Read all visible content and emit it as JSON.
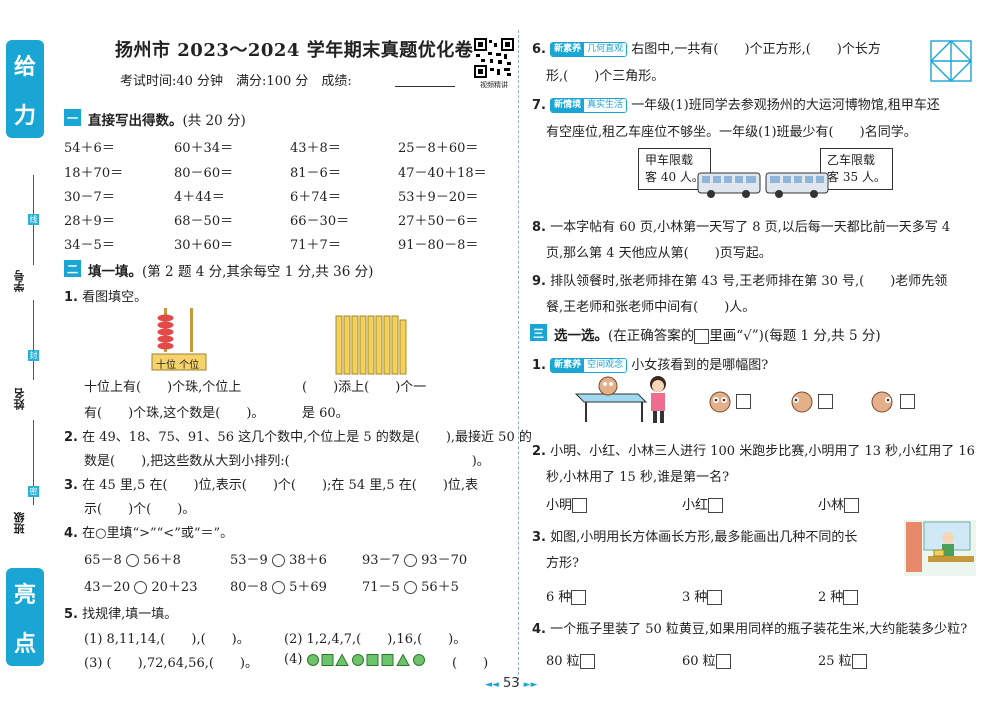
{
  "colors": {
    "accent": "#1aa6d4",
    "badge_green": "#2aa75a",
    "abacus_rod": "#c69a3c",
    "tab_text": "#ffffff"
  },
  "sidebar": {
    "top_tab": [
      "给",
      "力"
    ],
    "bottom_tab": [
      "亮",
      "点"
    ],
    "labels": [
      "学号",
      "姓名",
      "班级"
    ],
    "seals": [
      "线",
      "封",
      "密"
    ]
  },
  "header": {
    "title": "扬州市 2023～2024 学年期末真题优化卷",
    "subtitle": "考试时间:40 分钟　满分:100 分　成绩:",
    "qr_caption": "视频精讲"
  },
  "left": {
    "sec1": {
      "num": "一",
      "title": "直接写出得数。",
      "score": "(共 20 分)",
      "rows": [
        [
          "54＋6＝",
          "60＋34＝",
          "43＋8＝",
          "25－8＋60＝"
        ],
        [
          "18＋70＝",
          "80－60＝",
          "81－6＝",
          "47－40＋18＝"
        ],
        [
          "30－7＝",
          "4＋44＝",
          "6＋74＝",
          "53＋9－20＝"
        ],
        [
          "28＋9＝",
          "68－50＝",
          "66－30＝",
          "27＋50－6＝"
        ],
        [
          "34－5＝",
          "30＋60＝",
          "71＋7＝",
          "91－80－8＝"
        ]
      ]
    },
    "sec2": {
      "num": "二",
      "title": "填一填。",
      "score": "(第 2 题 4 分,其余每空 1 分,共 36 分)",
      "q1": {
        "n": "1.",
        "text": "看图填空。",
        "abacus_label": "十位 个位",
        "l1a": "十位上有(　　)个珠,个位上",
        "l1b": "(　　)添上(　　)个一",
        "l2a": "有(　　)个珠,这个数是(　　)。",
        "l2b": "是 60。"
      },
      "q2": {
        "n": "2.",
        "l1": "在 49、18、75、91、56 这几个数中,个位上是 5 的数是(　　),最接近 50 的",
        "l2": "数是(　　),把这些数从大到小排列:(　　　　　　　　　　　　　　)。"
      },
      "q3": {
        "n": "3.",
        "l1": "在 45 里,5 在(　　)位,表示(　　)个(　　);在 54 里,5 在(　　)位,表",
        "l2": "示(　　)个(　　)。"
      },
      "q4": {
        "n": "4.",
        "text": "在○里填“>”“<”或“＝”。",
        "rows": [
          [
            "65－8",
            "56＋8",
            "53－9",
            "38＋6",
            "93－7",
            "93－70"
          ],
          [
            "43－20",
            "20＋23",
            "80－8",
            "5＋69",
            "71－5",
            "56＋5"
          ]
        ]
      },
      "q5": {
        "n": "5.",
        "text": "找规律,填一填。",
        "p1": "(1) 8,11,14,(　　),(　　)。",
        "p2": "(2) 1,2,4,7,(　　),16,(　　)。",
        "p3": "(3) (　　),72,64,56,(　　)。",
        "p4": "(4)",
        "p4end": "(　　)"
      }
    }
  },
  "right": {
    "q6": {
      "n": "6.",
      "badge": [
        "新素养",
        "几何直观"
      ],
      "l1": "右图中,一共有(　　)个正方形,(　　)个长方",
      "l2": "形,(　　)个三角形。"
    },
    "q7": {
      "n": "7.",
      "badge": [
        "新情境",
        "真实生活"
      ],
      "l1": "一年级(1)班同学去参观扬州的大运河博物馆,租甲车还",
      "l2": "有空座位,租乙车座位不够坐。一年级(1)班最少有(　　)名同学。",
      "sign1": [
        "甲车限载",
        "客 40 人。"
      ],
      "sign2": [
        "乙车限载",
        "客 35 人。"
      ]
    },
    "q8": {
      "n": "8.",
      "l1": "一本字帖有 60 页,小林第一天写了 8 页,以后每一天都比前一天多写 4",
      "l2": "页,那么第 4 天他应从第(　　)页写起。"
    },
    "q9": {
      "n": "9.",
      "l1": "排队领餐时,张老师排在第 43 号,王老师排在第 30 号,(　　)老师先领",
      "l2": "餐,王老师和张老师中间有(　　)人。"
    },
    "sec3": {
      "num": "三",
      "title": "选一选。",
      "score_a": "(在正确答案的",
      "score_b": "里画“√”)(每题 1 分,共 5 分)"
    },
    "c1": {
      "n": "1.",
      "badge": [
        "新素养",
        "空间观念"
      ],
      "text": "小女孩看到的是哪幅图?"
    },
    "c2": {
      "n": "2.",
      "l1": "小明、小红、小林三人进行 100 米跑步比赛,小明用了 13 秒,小红用了 16",
      "l2": "秒,小林用了 15 秒,谁是第一名?",
      "opts": [
        "小明",
        "小红",
        "小林"
      ]
    },
    "c3": {
      "n": "3.",
      "l1": "如图,小明用长方体画长方形,最多能画出几种不同的长",
      "l2": "方形?",
      "opts": [
        "6 种",
        "3 种",
        "2 种"
      ]
    },
    "c4": {
      "n": "4.",
      "l1": "一个瓶子里装了 50 粒黄豆,如果用同样的瓶子装花生米,大约能装多少粒?",
      "opts": [
        "80 粒",
        "60 粒",
        "25 粒"
      ]
    }
  },
  "footer": {
    "page": "53"
  }
}
